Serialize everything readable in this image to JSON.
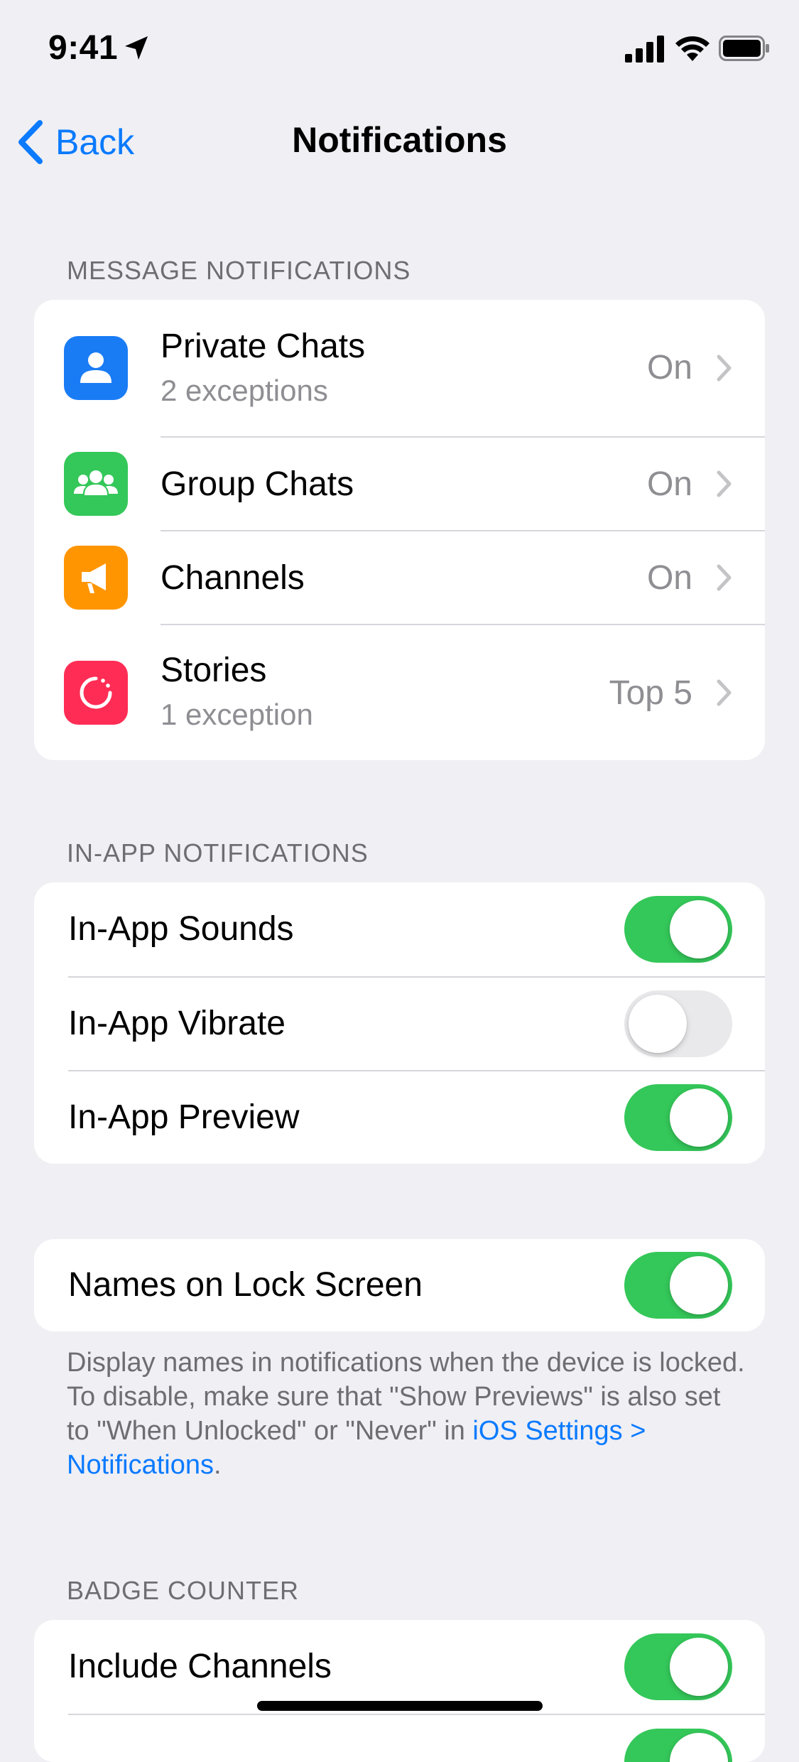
{
  "status_bar": {
    "time": "9:41",
    "icons": [
      "location-arrow-icon",
      "cellular-signal-icon",
      "wifi-icon",
      "battery-icon"
    ]
  },
  "nav": {
    "back_label": "Back",
    "title": "Notifications"
  },
  "message_notifications": {
    "header": "MESSAGE NOTIFICATIONS",
    "items": [
      {
        "title": "Private Chats",
        "subtitle": "2 exceptions",
        "value": "On",
        "icon": "person-icon",
        "color": "#1a7cf5"
      },
      {
        "title": "Group Chats",
        "subtitle": "",
        "value": "On",
        "icon": "group-icon",
        "color": "#34c759"
      },
      {
        "title": "Channels",
        "subtitle": "",
        "value": "On",
        "icon": "megaphone-icon",
        "color": "#ff9500"
      },
      {
        "title": "Stories",
        "subtitle": "1 exception",
        "value": "Top 5",
        "icon": "story-circle-icon",
        "color": "#ff2d55"
      }
    ]
  },
  "in_app_notifications": {
    "header": "IN-APP NOTIFICATIONS",
    "items": [
      {
        "title": "In-App Sounds",
        "on": true
      },
      {
        "title": "In-App Vibrate",
        "on": false
      },
      {
        "title": "In-App Preview",
        "on": true
      }
    ]
  },
  "lock_screen": {
    "title": "Names on Lock Screen",
    "on": true,
    "footnote_text": "Display names in notifications when the device is locked. To disable, make sure that \"Show Previews\" is also set to \"When Unlocked\" or \"Never\" in ",
    "footnote_link": "iOS Settings > Notifications",
    "footnote_end": "."
  },
  "badge_counter": {
    "header": "BADGE COUNTER",
    "items": [
      {
        "title": "Include Channels",
        "on": true
      }
    ]
  },
  "colors": {
    "accent": "#0a7aff",
    "toggle_on": "#34c759",
    "toggle_off": "#e9e9eb",
    "background": "#efeff4"
  }
}
